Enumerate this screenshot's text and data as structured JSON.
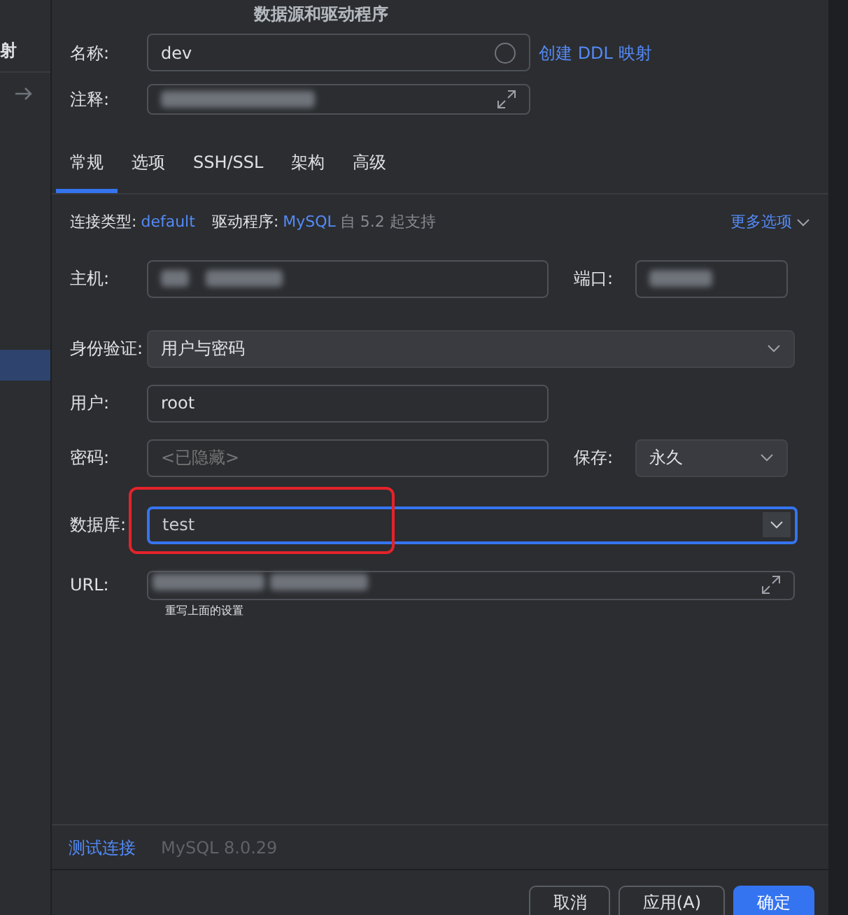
{
  "window": {
    "title": "数据源和驱动程序"
  },
  "sidebar": {
    "heading": "射"
  },
  "name_field": {
    "label": "名称:",
    "value": "dev"
  },
  "ddl_link": "创建 DDL 映射",
  "comment_field": {
    "label": "注释:"
  },
  "tabs": [
    {
      "label": "常规",
      "selected": true
    },
    {
      "label": "选项",
      "selected": false
    },
    {
      "label": "SSH/SSL",
      "selected": false
    },
    {
      "label": "架构",
      "selected": false
    },
    {
      "label": "高级",
      "selected": false
    }
  ],
  "info": {
    "connection_type_label": "连接类型:",
    "connection_type": "default",
    "driver_label": "驱动程序:",
    "driver": "MySQL",
    "driver_note": "自 5.2 起支持",
    "more_options": "更多选项"
  },
  "host": {
    "label": "主机:"
  },
  "port": {
    "label": "端口:"
  },
  "auth": {
    "label": "身份验证:",
    "value": "用户与密码"
  },
  "user": {
    "label": "用户:",
    "value": "root"
  },
  "password": {
    "label": "密码:",
    "placeholder": "<已隐藏>"
  },
  "save": {
    "label": "保存:",
    "value": "永久"
  },
  "database": {
    "label": "数据库:",
    "value": "test",
    "focused": true,
    "highlighted": true
  },
  "url": {
    "label": "URL:",
    "hint": "重写上面的设置"
  },
  "test_link": "测试连接",
  "server_version": "MySQL 8.0.29",
  "buttons": [
    {
      "label": "取消",
      "primary": false
    },
    {
      "label": "应用(A)",
      "primary": false
    },
    {
      "label": "确定",
      "primary": true
    }
  ]
}
